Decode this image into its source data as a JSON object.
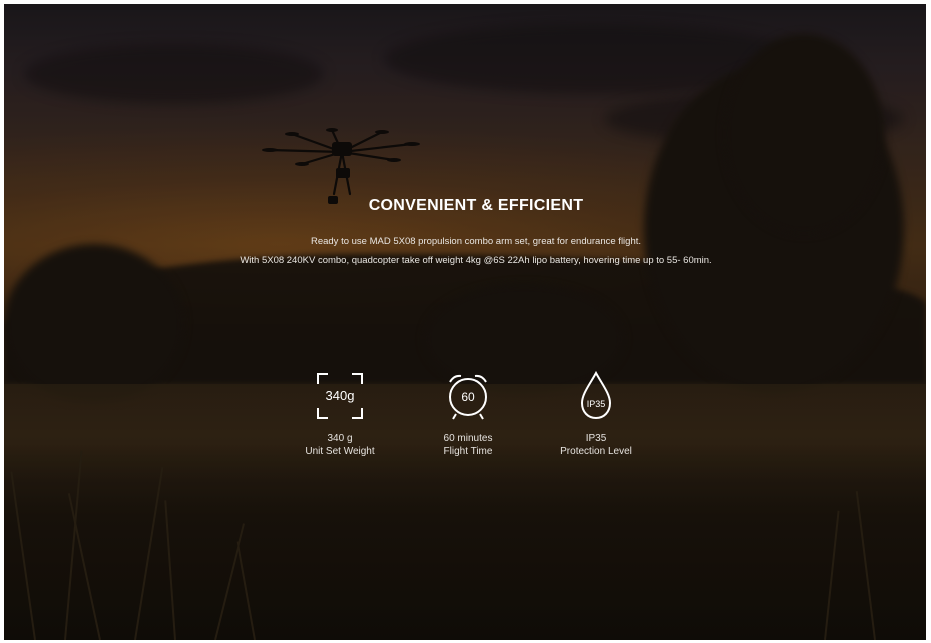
{
  "hero": {
    "title": "CONVENIENT & EFFICIENT",
    "description_line1": "Ready to use MAD 5X08 propulsion combo arm set, great for endurance flight.",
    "description_line2": "With 5X08 240KV combo, quadcopter take off weight 4kg @6S 22Ah lipo battery, hovering time up to 55- 60min."
  },
  "features": [
    {
      "icon": "weight-frame-icon",
      "icon_text": "340g",
      "value": "340 g",
      "label": "Unit Set Weight"
    },
    {
      "icon": "alarm-clock-icon",
      "icon_text": "60",
      "value": "60 minutes",
      "label": "Flight Time"
    },
    {
      "icon": "water-drop-icon",
      "icon_text": "IP35",
      "value": "IP35",
      "label": "Protection Level"
    }
  ]
}
